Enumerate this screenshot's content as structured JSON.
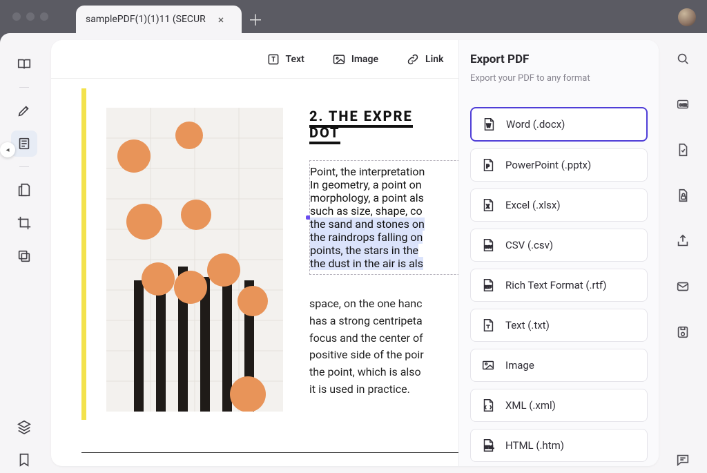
{
  "tab": {
    "title": "samplePDF(1)(1)11 (SECUR"
  },
  "toolbar": {
    "text_label": "Text",
    "image_label": "Image",
    "link_label": "Link"
  },
  "document": {
    "heading_line1": "2. THE EXPRE",
    "heading_line2": "DOT",
    "para1_plain1": "Point, the interpretation",
    "para1_plain2": "In geometry, a point on",
    "para1_plain3": "morphology, a point als",
    "para1_plain4": "such as size, shape, co",
    "para1_hl1": "the sand and stones on",
    "para1_hl2": "the raindrops falling on",
    "para1_hl3": "points, the stars in the",
    "para1_hl4": "the dust in the air is als",
    "para2_l1": "space, on the one hanc",
    "para2_l2": "has a strong centripeta",
    "para2_l3": "focus and the center of",
    "para2_l4": "positive side of the poir",
    "para2_l5": "the point, which is also",
    "para2_l6": "it is used in practice."
  },
  "export": {
    "title": "Export PDF",
    "subtitle": "Export your PDF to any format",
    "formats": {
      "word": "Word (.docx)",
      "ppt": "PowerPoint (.pptx)",
      "excel": "Excel (.xlsx)",
      "csv": "CSV (.csv)",
      "rtf": "Rich Text Format (.rtf)",
      "txt": "Text (.txt)",
      "image": "Image",
      "xml": "XML (.xml)",
      "html": "HTML (.htm)"
    }
  }
}
